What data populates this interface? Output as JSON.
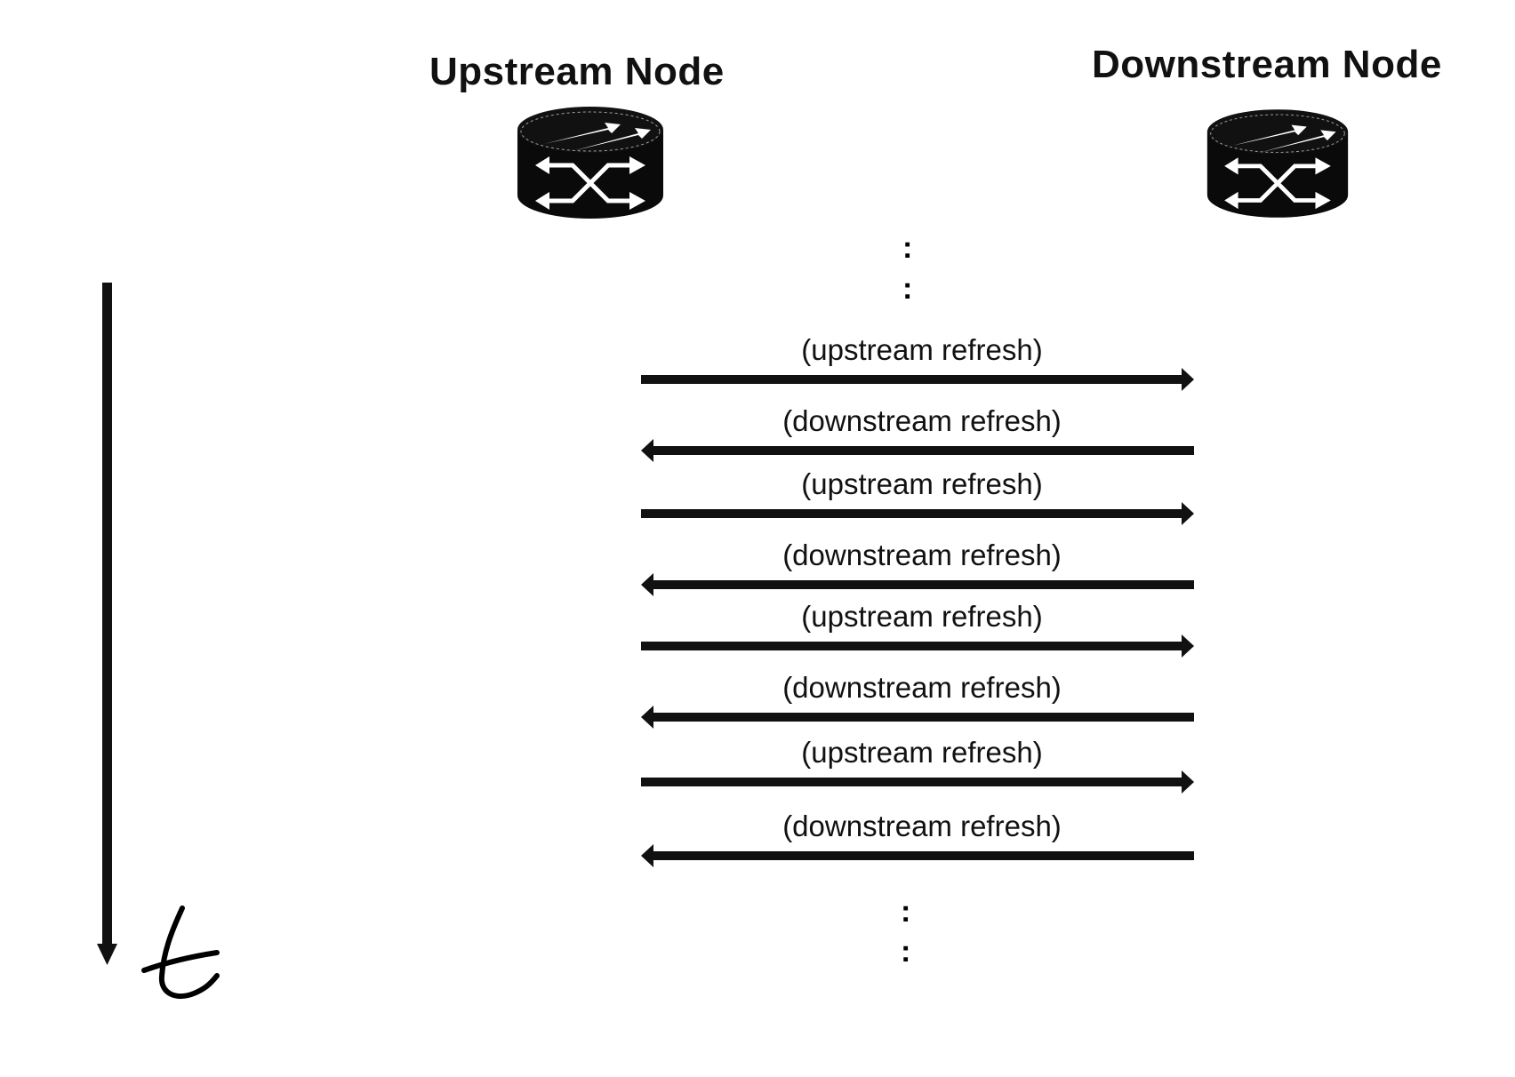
{
  "nodes": [
    {
      "id": "upstream",
      "title": "Upstream Node",
      "icon": "router-icon"
    },
    {
      "id": "downstream",
      "title": "Downstream Node",
      "icon": "router-icon"
    }
  ],
  "ellipsis": {
    "top": ":\n:",
    "bottom": ":\n:",
    "glyph": ":"
  },
  "messages": [
    {
      "label": "(upstream refresh)",
      "direction": "to-downstream"
    },
    {
      "label": "(downstream refresh)",
      "direction": "to-upstream"
    },
    {
      "label": "(upstream refresh)",
      "direction": "to-downstream"
    },
    {
      "label": "(downstream refresh)",
      "direction": "to-upstream"
    },
    {
      "label": "(upstream refresh)",
      "direction": "to-downstream"
    },
    {
      "label": "(downstream refresh)",
      "direction": "to-upstream"
    },
    {
      "label": "(upstream refresh)",
      "direction": "to-downstream"
    },
    {
      "label": "(downstream refresh)",
      "direction": "to-upstream"
    }
  ],
  "timeline": {
    "label": "t",
    "direction": "down"
  }
}
